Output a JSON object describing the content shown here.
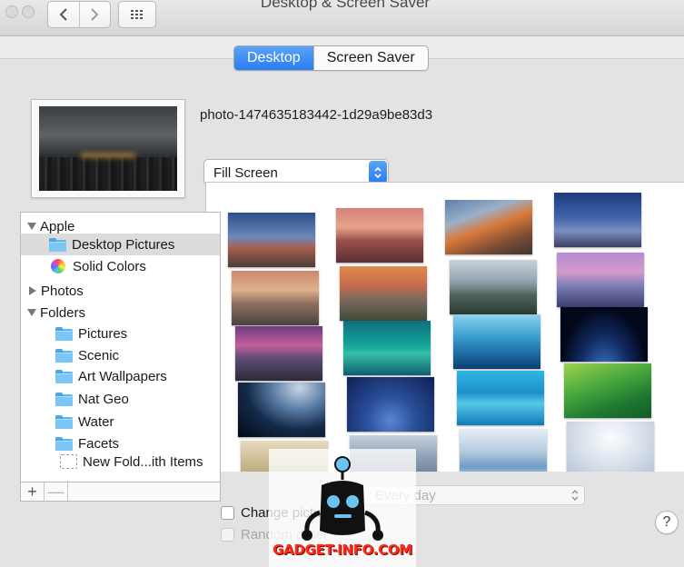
{
  "window": {
    "title": "Desktop & Screen Saver"
  },
  "tabs": [
    {
      "label": "Desktop",
      "active": true
    },
    {
      "label": "Screen Saver",
      "active": false
    }
  ],
  "current": {
    "photo_name": "photo-1474635183442-1d29a9be83d3",
    "fill_mode": "Fill Screen"
  },
  "sidebar": {
    "groups": [
      {
        "label": "Apple",
        "expanded": true,
        "items": [
          {
            "label": "Desktop Pictures",
            "icon": "folder-icon",
            "selected": true
          },
          {
            "label": "Solid Colors",
            "icon": "color-wheel-icon",
            "selected": false
          }
        ]
      },
      {
        "label": "Photos",
        "expanded": false,
        "items": []
      },
      {
        "label": "Folders",
        "expanded": true,
        "items": [
          {
            "label": "Pictures",
            "icon": "pictures-folder-icon"
          },
          {
            "label": "Scenic",
            "icon": "folder-icon"
          },
          {
            "label": "Art Wallpapers",
            "icon": "folder-icon"
          },
          {
            "label": "Nat Geo",
            "icon": "folder-icon"
          },
          {
            "label": "Water",
            "icon": "folder-icon"
          },
          {
            "label": "Facets",
            "icon": "folder-icon"
          },
          {
            "label": "New Fold...ith Items",
            "icon": "dashed-folder-icon"
          }
        ]
      }
    ],
    "add_label": "+",
    "remove_label": "—"
  },
  "options": {
    "change_picture_label": "Change picture:",
    "interval": "Every day",
    "random_label": "Random order"
  },
  "help_label": "?",
  "watermark": {
    "text": "GADGET-INFO.COM"
  },
  "colors": {
    "accent": "#2a7cf0",
    "watermark_text": "#ff2a1a"
  }
}
